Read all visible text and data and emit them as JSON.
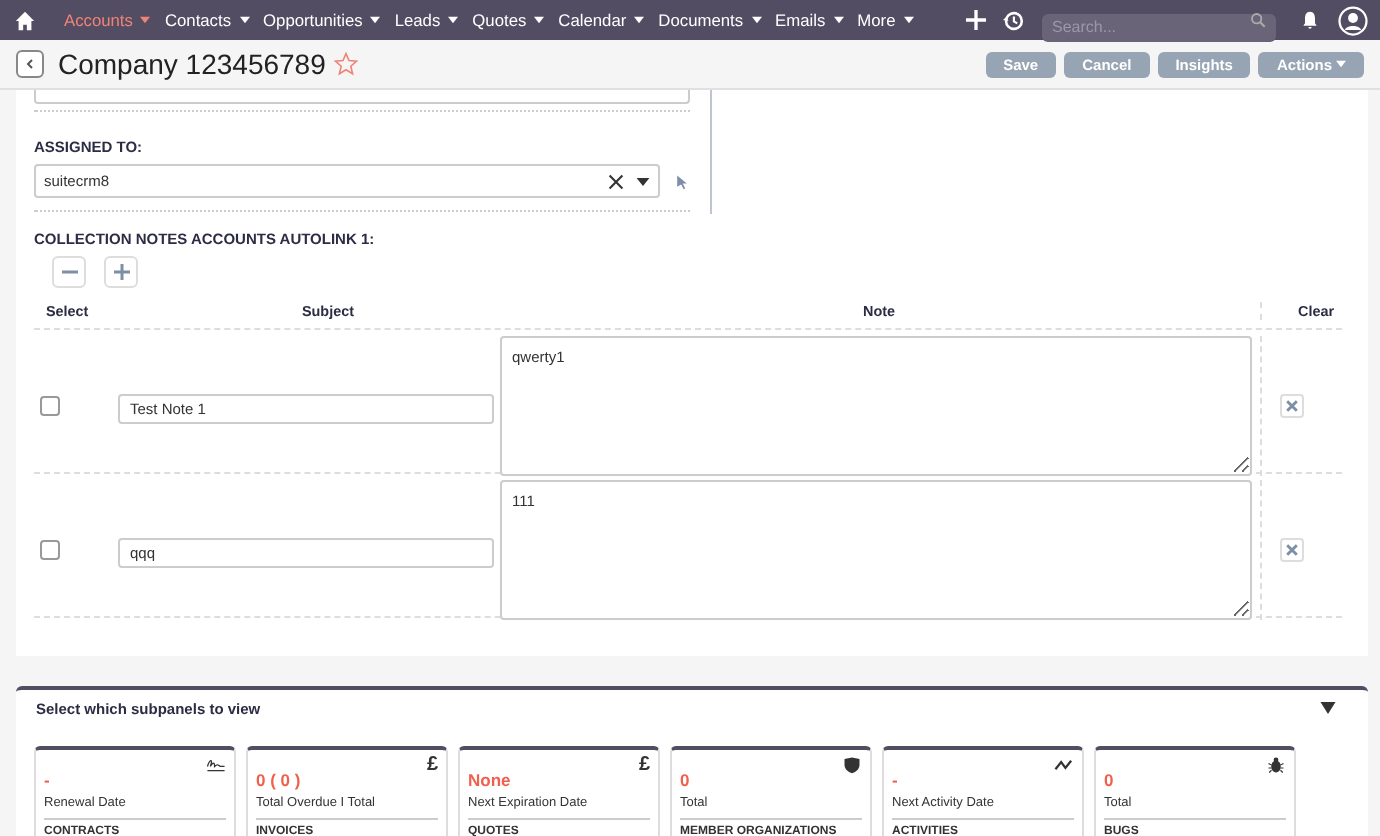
{
  "nav": {
    "items": [
      {
        "label": "Accounts",
        "selected": true
      },
      {
        "label": "Contacts",
        "selected": false
      },
      {
        "label": "Opportunities",
        "selected": false
      },
      {
        "label": "Leads",
        "selected": false
      },
      {
        "label": "Quotes",
        "selected": false
      },
      {
        "label": "Calendar",
        "selected": false
      },
      {
        "label": "Documents",
        "selected": false
      },
      {
        "label": "Emails",
        "selected": false
      },
      {
        "label": "More",
        "selected": false
      }
    ],
    "search": {
      "placeholder": "Search..."
    }
  },
  "header": {
    "title": "Company 123456789",
    "favorite": false,
    "buttons": [
      "Save",
      "Cancel",
      "Insights",
      "Actions"
    ]
  },
  "form": {
    "assigned_label": "ASSIGNED TO:",
    "assigned_value": "suitecrm8",
    "collection_title": "COLLECTION NOTES ACCOUNTS AUTOLINK 1:",
    "columns": [
      "Select",
      "Subject",
      "Note",
      "Clear"
    ],
    "rows": [
      {
        "checked": false,
        "subject": "Test Note 1",
        "note": "qwerty1"
      },
      {
        "checked": false,
        "subject": "qqq",
        "note": "111"
      }
    ]
  },
  "subpanels": {
    "title": "Select which subpanels to view",
    "cards": [
      {
        "kind": "signature",
        "value": "-",
        "label": "Renewal Date",
        "name": "CONTRACTS"
      },
      {
        "kind": "pound",
        "icon": "£",
        "value": "0 ( 0 )",
        "label": "Total Overdue I Total",
        "name": "INVOICES"
      },
      {
        "kind": "pound",
        "icon": "£",
        "value": "None",
        "label": "Next Expiration Date",
        "name": "QUOTES"
      },
      {
        "kind": "shield",
        "value": "0",
        "label": "Total",
        "name": "MEMBER ORGANIZATIONS"
      },
      {
        "kind": "trend",
        "value": "-",
        "label": "Next Activity Date",
        "name": "ACTIVITIES"
      },
      {
        "kind": "bug",
        "value": "0",
        "label": "Total",
        "name": "BUGS"
      }
    ]
  }
}
